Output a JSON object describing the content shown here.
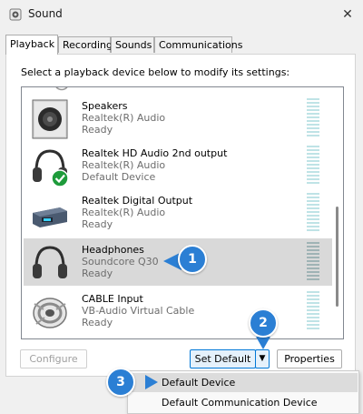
{
  "window": {
    "title": "Sound",
    "close_glyph": "✕"
  },
  "tabs": [
    {
      "label": "Playback"
    },
    {
      "label": "Recording"
    },
    {
      "label": "Sounds"
    },
    {
      "label": "Communications"
    }
  ],
  "instruction": "Select a playback device below to modify its settings:",
  "devices": [
    {
      "name": "Speakers",
      "sub": "Realtek(R) Audio",
      "status": "Ready",
      "icon": "speaker-icon"
    },
    {
      "name": "Realtek HD Audio 2nd output",
      "sub": "Realtek(R) Audio",
      "status": "Default Device",
      "icon": "headphones-default-icon"
    },
    {
      "name": "Realtek Digital Output",
      "sub": "Realtek(R) Audio",
      "status": "Ready",
      "icon": "digital-output-icon"
    },
    {
      "name": "Headphones",
      "sub": "Soundcore Q30",
      "status": "Ready",
      "icon": "headphones-icon",
      "selected": true
    },
    {
      "name": "CABLE Input",
      "sub": "VB-Audio Virtual Cable",
      "status": "Ready",
      "icon": "cable-icon"
    }
  ],
  "buttons": {
    "configure": "Configure",
    "set_default": "Set Default",
    "dropdown_glyph": "▼",
    "properties": "Properties"
  },
  "menu": {
    "items": [
      "Default Device",
      "Default Communication Device"
    ]
  },
  "badges": [
    "1",
    "2",
    "3"
  ],
  "colors": {
    "badge": "#2b7fd4",
    "selected_row": "#d9d9d9",
    "meter": "#bfe3e6",
    "check": "#1e9b3b"
  }
}
